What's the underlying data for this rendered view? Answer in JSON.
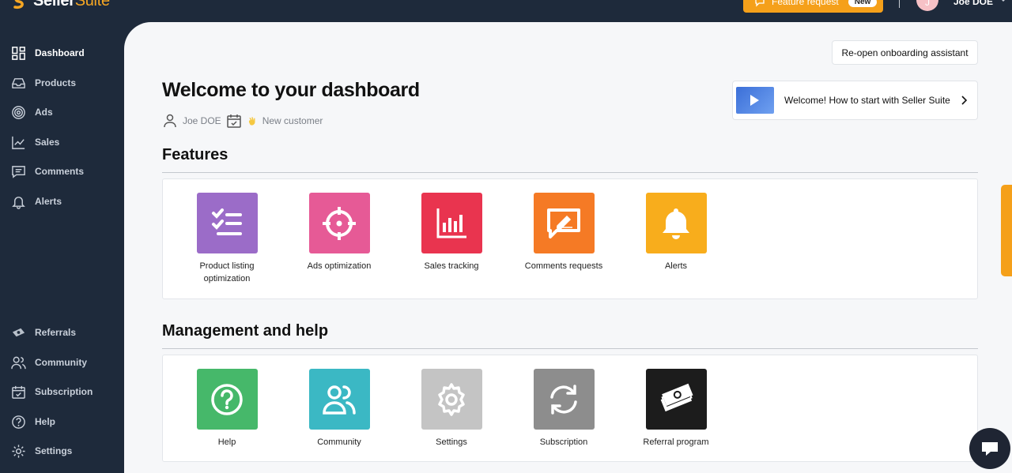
{
  "brand": {
    "name_main": "Seller",
    "name_accent": "Suite"
  },
  "header": {
    "feature_request_label": "Feature request",
    "new_badge": "New",
    "avatar_initial": "J",
    "user_name": "Joe DOE"
  },
  "sidebar": {
    "top_items": [
      {
        "label": "Dashboard",
        "icon": "dashboard-icon",
        "active": true
      },
      {
        "label": "Products",
        "icon": "inbox-icon"
      },
      {
        "label": "Ads",
        "icon": "target-icon"
      },
      {
        "label": "Sales",
        "icon": "line-chart-icon"
      },
      {
        "label": "Comments",
        "icon": "comment-icon"
      },
      {
        "label": "Alerts",
        "icon": "bell-icon"
      }
    ],
    "bottom_items": [
      {
        "label": "Referrals",
        "icon": "money-icon"
      },
      {
        "label": "Community",
        "icon": "users-icon"
      },
      {
        "label": "Subscription",
        "icon": "calendar-check-icon"
      },
      {
        "label": "Help",
        "icon": "question-icon"
      },
      {
        "label": "Settings",
        "icon": "gear-icon"
      }
    ]
  },
  "main": {
    "reopen_label": "Re-open onboarding assistant",
    "title": "Welcome to your dashboard",
    "user_name": "Joe DOE",
    "status": "New customer",
    "video_title": "Welcome! How to start with Seller Suite",
    "features_title": "Features",
    "features": [
      {
        "label": "Product listing optimization",
        "icon": "checklist-icon",
        "color": "#9b6cc8"
      },
      {
        "label": "Ads optimization",
        "icon": "crosshair-icon",
        "color": "#e65a96"
      },
      {
        "label": "Sales tracking",
        "icon": "bar-chart-icon",
        "color": "#e9344f"
      },
      {
        "label": "Comments requests",
        "icon": "edit-comment-icon",
        "color": "#f57a25"
      },
      {
        "label": "Alerts",
        "icon": "bell-icon",
        "color": "#f8ad1c"
      }
    ],
    "management_title": "Management and help",
    "management": [
      {
        "label": "Help",
        "icon": "question-icon",
        "color": "#46b86a"
      },
      {
        "label": "Community",
        "icon": "users-icon",
        "color": "#3bb8c4"
      },
      {
        "label": "Settings",
        "icon": "gear-icon",
        "color": "#c4c4c4"
      },
      {
        "label": "Subscription",
        "icon": "refresh-icon",
        "color": "#8d8d8d"
      },
      {
        "label": "Referral program",
        "icon": "money-stack-icon",
        "color": "#1c1c1c"
      }
    ]
  },
  "colors": {
    "sidebar": "#1e2a3b",
    "accent": "#f5a01a",
    "background": "#f6f7f9"
  }
}
